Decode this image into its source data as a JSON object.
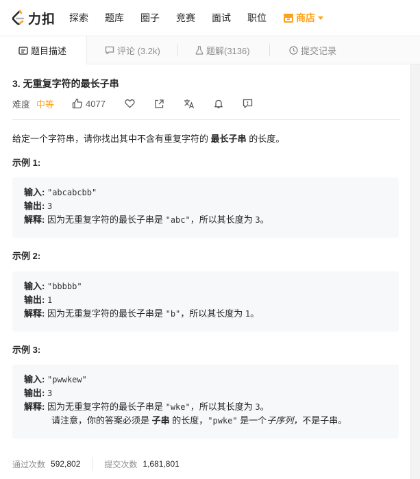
{
  "brand": {
    "logo_text": "力扣"
  },
  "nav": {
    "items": [
      "探索",
      "题库",
      "圈子",
      "竞赛",
      "面试",
      "职位"
    ],
    "store_label": "商店"
  },
  "tabs": [
    {
      "label": "题目描述",
      "icon": "description-icon"
    },
    {
      "label": "评论 (3.2k)",
      "icon": "comment-icon"
    },
    {
      "label": "题解(3136)",
      "icon": "flask-icon"
    },
    {
      "label": "提交记录",
      "icon": "clock-icon"
    }
  ],
  "problem": {
    "title": "3. 无重复字符的最长子串",
    "difficulty_label": "难度",
    "difficulty": "中等",
    "likes": "4077",
    "description_prefix": "给定一个字符串，请你找出其中不含有重复字符的 ",
    "description_bold": "最长子串",
    "description_suffix": " 的长度。"
  },
  "examples": [
    {
      "heading": "示例 1:",
      "input_label": "输入:",
      "input": "\"abcabcbb\"",
      "output_label": "输出:",
      "output": "3",
      "explain_label": "解释:",
      "explain_prefix": "因为无重复字符的最长子串是 ",
      "explain_code": "\"abc\"",
      "explain_mid": "，所以其长度为 ",
      "explain_num": "3",
      "explain_end": "。"
    },
    {
      "heading": "示例 2:",
      "input_label": "输入:",
      "input": "\"bbbbb\"",
      "output_label": "输出:",
      "output": "1",
      "explain_label": "解释:",
      "explain_prefix": "因为无重复字符的最长子串是 ",
      "explain_code": "\"b\"",
      "explain_mid": "，所以其长度为 ",
      "explain_num": "1",
      "explain_end": "。"
    },
    {
      "heading": "示例 3:",
      "input_label": "输入:",
      "input": "\"pwwkew\"",
      "output_label": "输出:",
      "output": "3",
      "explain_label": "解释:",
      "explain_prefix": "因为无重复字符的最长子串是 ",
      "explain_code": "\"wke\"",
      "explain_mid": "，所以其长度为 ",
      "explain_num": "3",
      "explain_end": "。",
      "note_prefix": "请注意，你的答案必须是 ",
      "note_bold": "子串",
      "note_mid": " 的长度，",
      "note_code": "\"pwke\"",
      "note_mid2": " 是一个",
      "note_italic": "子序列，",
      "note_end": "不是子串。"
    }
  ],
  "stats": {
    "accepted_label": "通过次数",
    "accepted": "592,802",
    "submitted_label": "提交次数",
    "submitted": "1,681,801"
  },
  "colors": {
    "accent": "#ffa116",
    "text": "#262626",
    "muted": "#8c8c8c",
    "code_bg": "#f7f8fa"
  }
}
